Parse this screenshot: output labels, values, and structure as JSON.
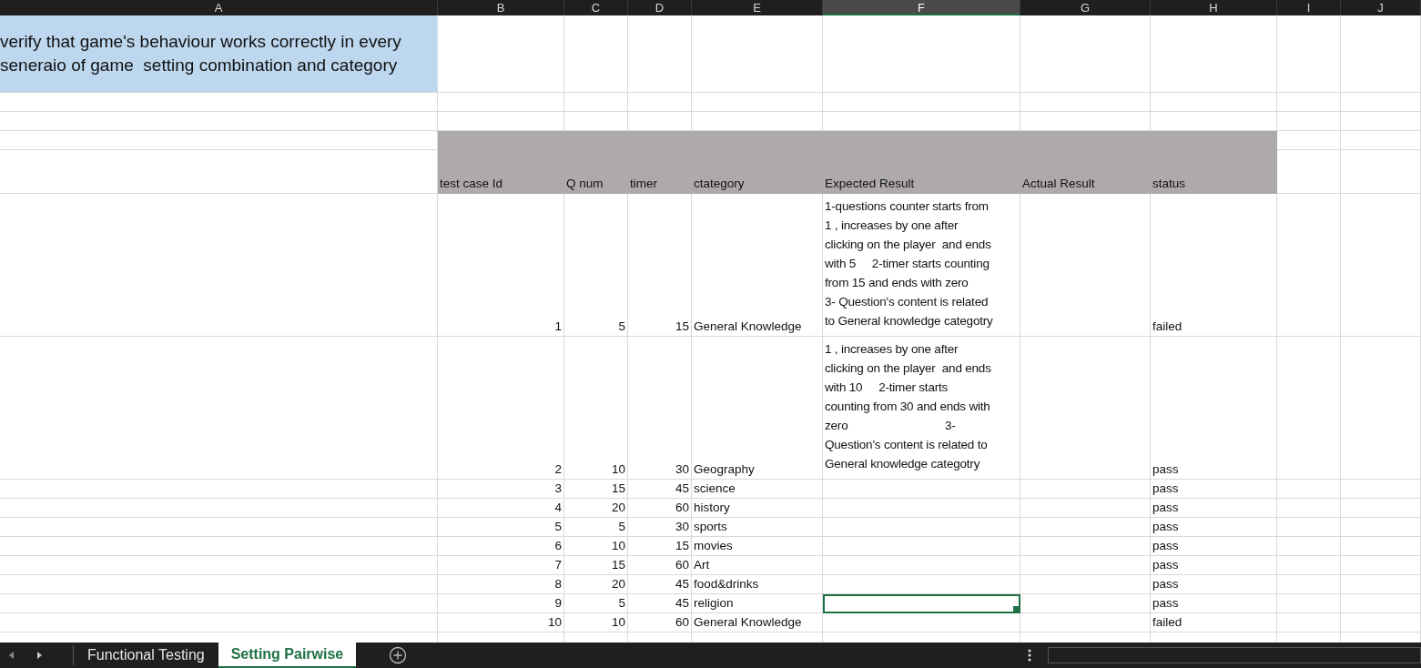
{
  "column_headers": [
    {
      "label": "A",
      "selected": false
    },
    {
      "label": "B",
      "selected": false
    },
    {
      "label": "C",
      "selected": false
    },
    {
      "label": "D",
      "selected": false
    },
    {
      "label": "E",
      "selected": false
    },
    {
      "label": "F",
      "selected": true
    },
    {
      "label": "G",
      "selected": false
    },
    {
      "label": "H",
      "selected": false
    },
    {
      "label": "I",
      "selected": false
    },
    {
      "label": "J",
      "selected": false
    }
  ],
  "title": "verify that game's behaviour works correctly in every seneraio of game  setting combination and category",
  "table": {
    "columns": [
      "test case Id",
      "Q num",
      "timer",
      "ctategory",
      "Expected Result",
      "Actual Result",
      "status"
    ],
    "rows": [
      {
        "id": "1",
        "q_num": "5",
        "timer": "15",
        "category": "General Knowledge",
        "expected_result": [
          "1-questions counter starts from",
          "1 , increases by one after",
          "clicking on the player  and ends",
          "with 5     2-timer starts counting",
          "from 15 and ends with zero",
          "3- Question's content is related",
          "to General knowledge categotry"
        ],
        "status": "failed",
        "selected": false
      },
      {
        "id": "2",
        "q_num": "10",
        "timer": "30",
        "category": "Geography",
        "expected_result": [
          "1 , increases by one after",
          "clicking on the player  and ends",
          "with 10     2-timer starts",
          "counting from 30 and ends with",
          "zero                              3-",
          "Question's content is related to",
          "General knowledge categotry"
        ],
        "status": "pass",
        "selected": false
      },
      {
        "id": "3",
        "q_num": "15",
        "timer": "45",
        "category": "science",
        "status": "pass",
        "selected": false
      },
      {
        "id": "4",
        "q_num": "20",
        "timer": "60",
        "category": "history",
        "status": "pass",
        "selected": false
      },
      {
        "id": "5",
        "q_num": "5",
        "timer": "30",
        "category": "sports",
        "status": "pass",
        "selected": false
      },
      {
        "id": "6",
        "q_num": "10",
        "timer": "15",
        "category": "movies",
        "status": "pass",
        "selected": false
      },
      {
        "id": "7",
        "q_num": "15",
        "timer": "60",
        "category": "Art",
        "status": "pass",
        "selected": false
      },
      {
        "id": "8",
        "q_num": "20",
        "timer": "45",
        "category": "food&drinks",
        "status": "pass",
        "selected": false
      },
      {
        "id": "9",
        "q_num": "5",
        "timer": "45",
        "category": "religion",
        "status": "pass",
        "selected": true
      },
      {
        "id": "10",
        "q_num": "10",
        "timer": "60",
        "category": "General Knowledge",
        "status": "failed",
        "selected": false
      }
    ]
  },
  "sheet_tabs": [
    {
      "label": "Functional Testing",
      "selected": false
    },
    {
      "label": "Setting Pairwise",
      "selected": true
    }
  ]
}
